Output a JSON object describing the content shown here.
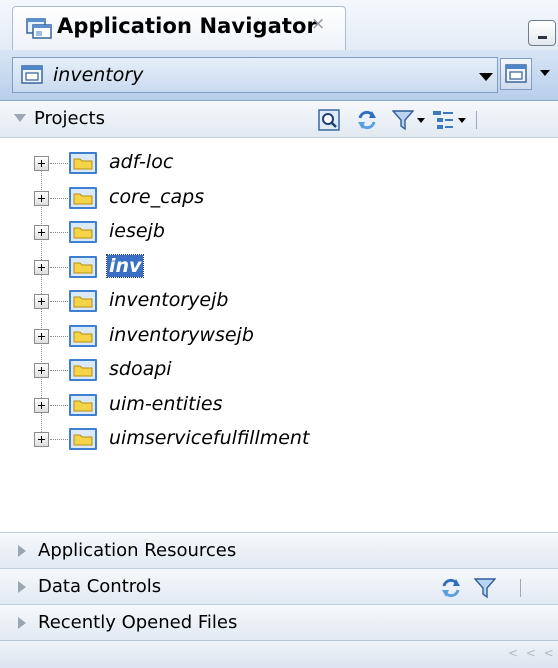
{
  "window": {
    "tab_title": "Application Navigator",
    "close_glyph": "×",
    "icon": "application-navigator-icon"
  },
  "application": {
    "selected": "inventory",
    "icon": "application-icon"
  },
  "projects": {
    "header_label": "Projects",
    "toolbar_icons": [
      "project-properties-icon",
      "refresh-icon",
      "filter-icon",
      "working-sets-icon"
    ],
    "items": [
      {
        "label": "adf-loc",
        "selected": false
      },
      {
        "label": "core_caps",
        "selected": false
      },
      {
        "label": "iesejb",
        "selected": false
      },
      {
        "label": "inv",
        "selected": true
      },
      {
        "label": "inventoryejb",
        "selected": false
      },
      {
        "label": "inventorywsejb",
        "selected": false
      },
      {
        "label": "sdoapi",
        "selected": false
      },
      {
        "label": "uim-entities",
        "selected": false
      },
      {
        "label": "uimservicefulfillment",
        "selected": false
      }
    ]
  },
  "panels": {
    "application_resources": "Application Resources",
    "data_controls": "Data Controls",
    "recently_opened_files": "Recently Opened Files"
  },
  "status": {
    "scroll_hint": "< < <"
  },
  "colors": {
    "selection": "#3a6fc4",
    "folder_yellow": "#f6d44a",
    "folder_blue": "#3f7fd0",
    "header_blue": "#b8cfea"
  }
}
